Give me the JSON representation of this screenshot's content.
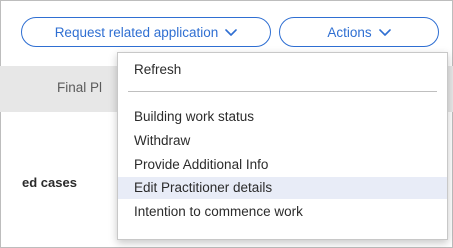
{
  "toolbar": {
    "request_button_label": "Request related application",
    "actions_button_label": "Actions"
  },
  "tab": {
    "label": "Final Pl"
  },
  "section": {
    "heading": "ed cases"
  },
  "actions_menu": {
    "items": [
      {
        "label": "Refresh"
      },
      {
        "label": "Building work status"
      },
      {
        "label": "Withdraw"
      },
      {
        "label": "Provide Additional Info"
      },
      {
        "label": "Edit Practitioner details",
        "highlighted": true
      },
      {
        "label": "Intention to commence work"
      }
    ]
  },
  "colors": {
    "accent": "#2f6fd2",
    "tab_background": "#e7e7e7",
    "menu_highlight": "#e8ecf7"
  }
}
